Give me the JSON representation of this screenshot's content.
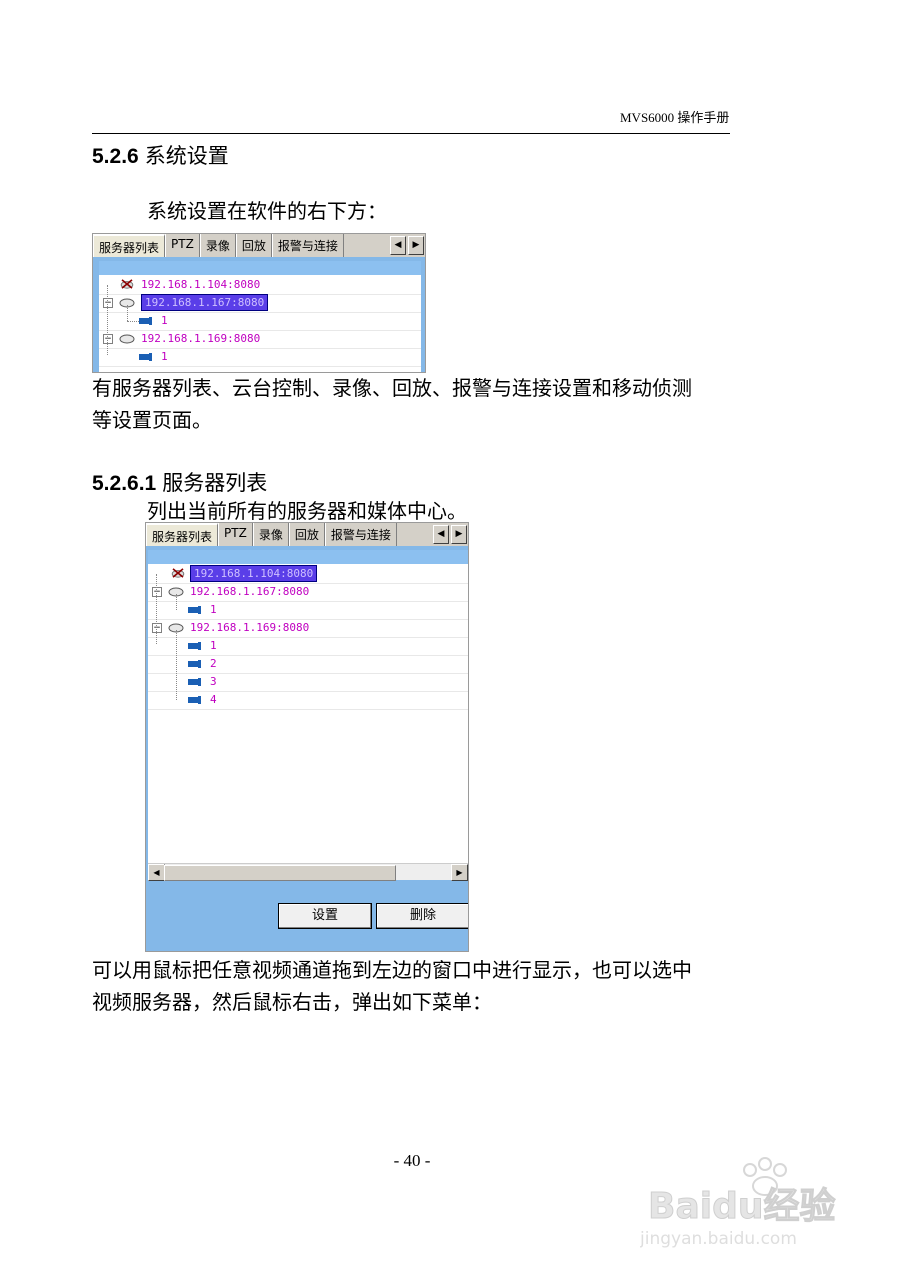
{
  "header": {
    "doc_title": "MVS6000 操作手册"
  },
  "section": {
    "number": "5.2.6",
    "title": "系统设置"
  },
  "intro": "系统设置在软件的右下方：",
  "tabs": [
    "服务器列表",
    "PTZ",
    "录像",
    "回放",
    "报警与连接"
  ],
  "tab_arrows": {
    "left": "◀",
    "right": "▶"
  },
  "shot1": {
    "rows": [
      {
        "text": "192.168.1.104:8080",
        "icon": "disconnected-server-icon"
      },
      {
        "text": "192.168.1.167:8080",
        "icon": "server-icon",
        "selected": true
      },
      {
        "text": "1",
        "icon": "camera-icon"
      },
      {
        "text": "192.168.1.169:8080",
        "icon": "server-icon"
      },
      {
        "text": "1",
        "icon": "camera-icon"
      }
    ]
  },
  "desc": "有服务器列表、云台控制、录像、回放、报警与连接设置和移动侦测等设置页面。",
  "desc_line1": "有服务器列表、云台控制、录像、回放、报警与连接设置和移动侦测",
  "desc_line2": "等设置页面。",
  "subsection": {
    "number": "5.2.6.1",
    "title": "服务器列表"
  },
  "sub_intro": "列出当前所有的服务器和媒体中心。",
  "shot2": {
    "rows": [
      {
        "text": "192.168.1.104:8080",
        "icon": "disconnected-server-icon",
        "selected": true
      },
      {
        "text": "192.168.1.167:8080",
        "icon": "server-icon"
      },
      {
        "text": "1",
        "icon": "camera-icon"
      },
      {
        "text": "192.168.1.169:8080",
        "icon": "server-icon"
      },
      {
        "text": "1",
        "icon": "camera-icon"
      },
      {
        "text": "2",
        "icon": "camera-icon"
      },
      {
        "text": "3",
        "icon": "camera-icon"
      },
      {
        "text": "4",
        "icon": "camera-icon"
      }
    ],
    "buttons": {
      "settings": "设置",
      "delete": "删除"
    },
    "scroll_arrows": {
      "left": "◀",
      "right": "▶"
    }
  },
  "outro_line1": "可以用鼠标把任意视频通道拖到左边的窗口中进行显示，也可以选中",
  "outro_line2": "视频服务器，然后鼠标右击，弹出如下菜单：",
  "page_number": "- 40 -",
  "watermark": {
    "brand": "Baidu经验",
    "url": "jingyan.baidu.com"
  },
  "colors": {
    "tree_text": "#c000c0",
    "selection": "#5a3ee8",
    "panel": "#84b8e8"
  }
}
